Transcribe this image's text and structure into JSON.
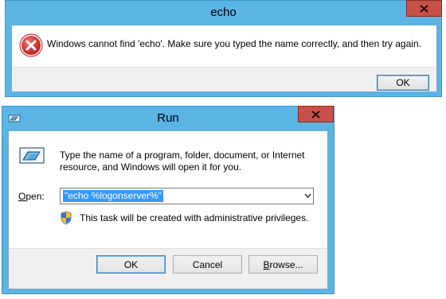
{
  "echo_dialog": {
    "title": "echo",
    "message": "Windows cannot find 'echo'. Make sure you typed the name correctly, and then try again.",
    "ok_label": "OK",
    "icon": "error-icon"
  },
  "run_dialog": {
    "title": "Run",
    "description": "Type the name of a program, folder, document, or Internet resource, and Windows will open it for you.",
    "open_label_prefix": "O",
    "open_label_rest": "pen:",
    "open_value": "\"echo %logonserver%\"",
    "admin_note": "This task will be created with administrative privileges.",
    "buttons": {
      "ok": "OK",
      "cancel": "Cancel",
      "browse_prefix": "B",
      "browse_rest": "rowse..."
    }
  },
  "colors": {
    "frame": "#5ab4e4",
    "close": "#c7504a",
    "selection": "#3399ff"
  }
}
